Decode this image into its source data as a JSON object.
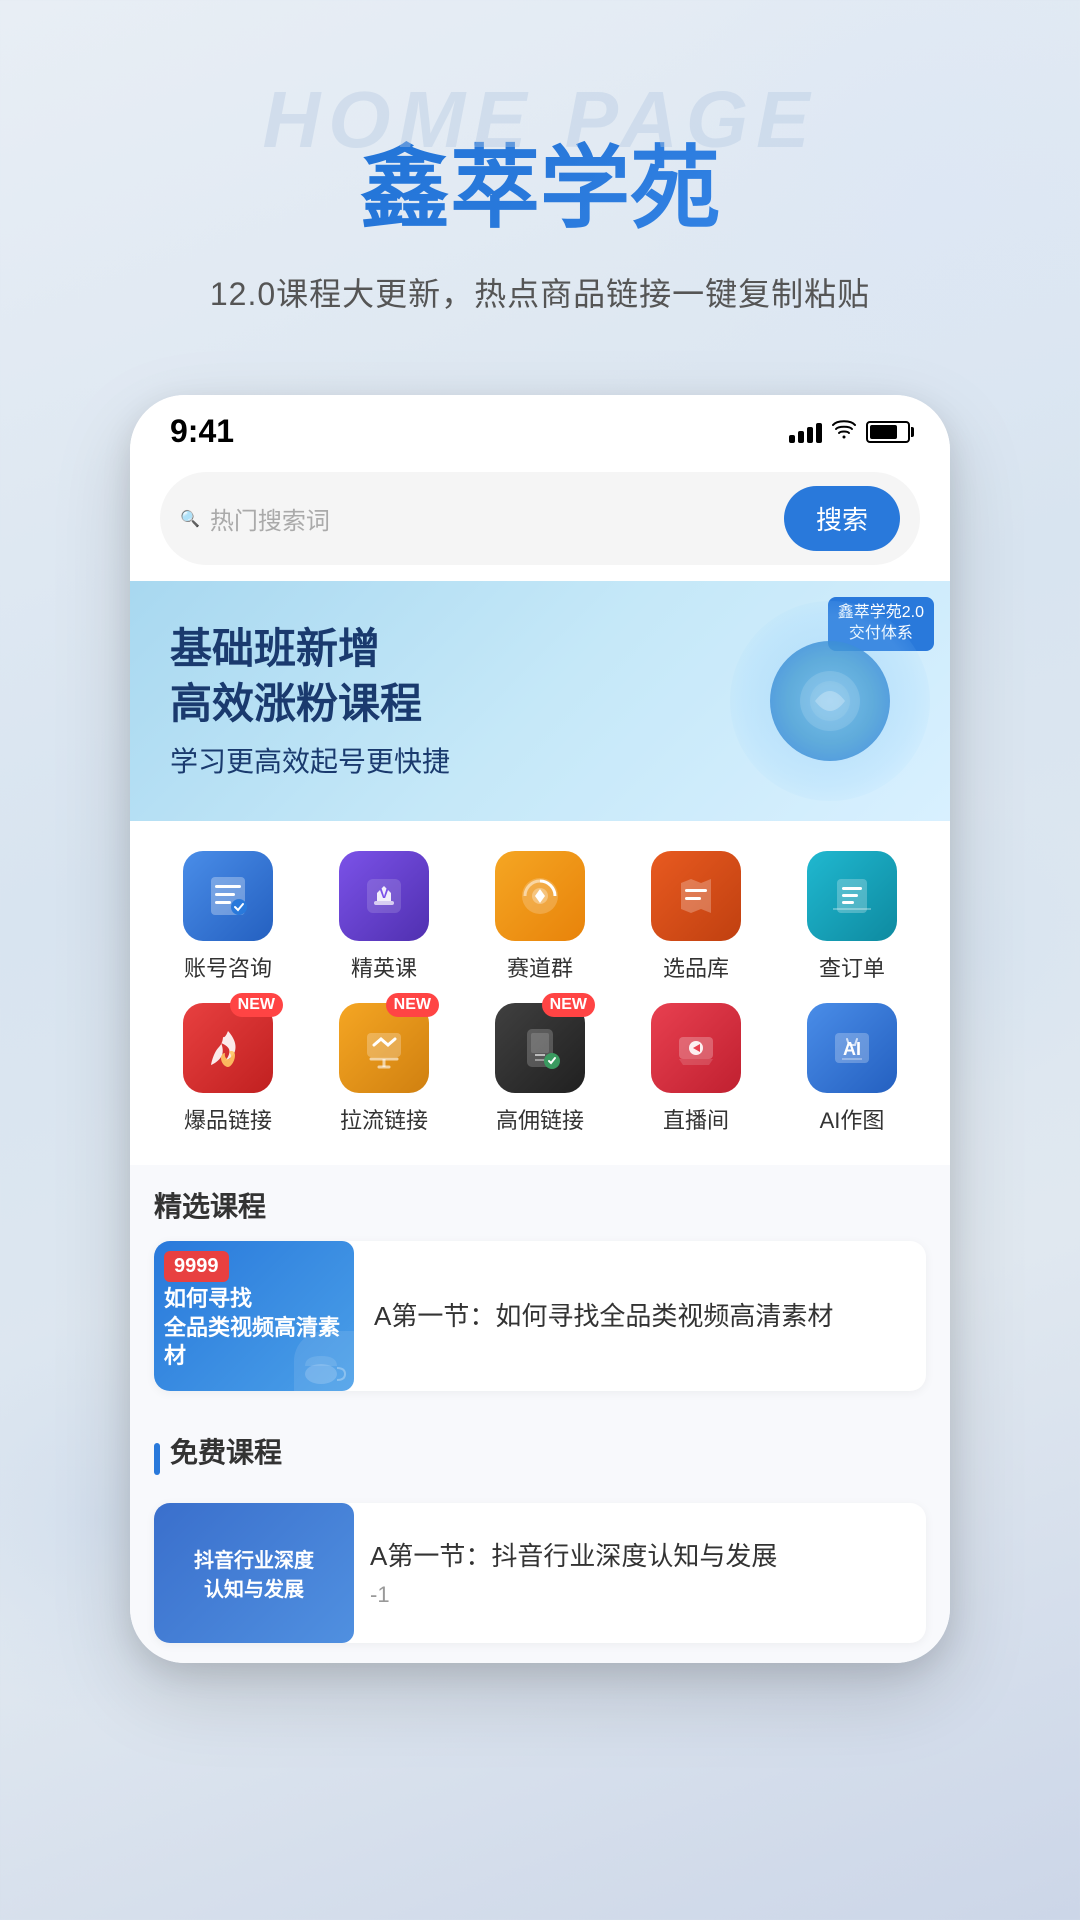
{
  "background": {
    "watermark": "HOME PAGE",
    "title": "鑫萃学苑",
    "subtitle": "12.0课程大更新，热点商品链接一键复制粘贴"
  },
  "phone": {
    "statusBar": {
      "time": "9:41",
      "signal": 4,
      "wifi": true,
      "battery": 75
    },
    "searchBar": {
      "placeholder": "热门搜索词",
      "buttonLabel": "搜索"
    },
    "banner": {
      "title1": "基础班新增",
      "title2": "高效涨粉课程",
      "subtitle": "学习更高效起号更快捷",
      "badge": "鑫萃学苑2.0\n交付体系"
    },
    "menuGrid": {
      "row1": [
        {
          "id": "account",
          "label": "账号咨询",
          "iconType": "icon-account",
          "new": false
        },
        {
          "id": "elite",
          "label": "精英课",
          "iconType": "icon-elite",
          "new": false
        },
        {
          "id": "race",
          "label": "赛道群",
          "iconType": "icon-race",
          "new": false
        },
        {
          "id": "select",
          "label": "选品库",
          "iconType": "icon-select",
          "new": false
        },
        {
          "id": "order",
          "label": "查订单",
          "iconType": "icon-order",
          "new": false
        }
      ],
      "row2": [
        {
          "id": "hot",
          "label": "爆品链接",
          "iconType": "icon-hot",
          "new": true
        },
        {
          "id": "pull",
          "label": "拉流链接",
          "iconType": "icon-pull",
          "new": true
        },
        {
          "id": "high",
          "label": "高佣链接",
          "iconType": "icon-high",
          "new": true
        },
        {
          "id": "live",
          "label": "直播间",
          "iconType": "icon-live",
          "new": false
        },
        {
          "id": "ai",
          "label": "AI作图",
          "iconType": "icon-ai",
          "new": false
        }
      ]
    },
    "featuredSection": {
      "title": "精选课程",
      "course": {
        "price": "9999",
        "thumbText": "如何寻找\n全品类视频高清素材",
        "title": "A第一节：如何寻找全品类视频高清素材"
      }
    },
    "freeSection": {
      "title": "免费课程",
      "course": {
        "thumbText": "抖音行业深度\n认知与发展",
        "title": "A第一节：抖音行业深度认知与发展",
        "num": "-1"
      }
    }
  },
  "icons": {
    "newBadge": "NEW",
    "search": "🔍"
  }
}
